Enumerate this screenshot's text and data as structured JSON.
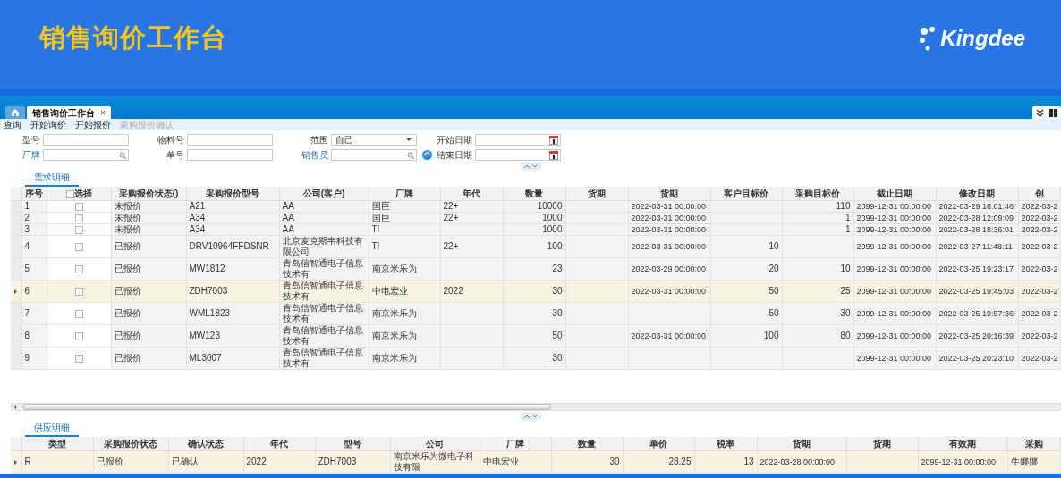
{
  "slide": {
    "title": "销售询价工作台",
    "logo": "Kingdee"
  },
  "tabs": [
    {
      "kind": "home",
      "selected": false
    },
    {
      "kind": "page",
      "label": "销售询价工作台",
      "close": "×",
      "selected": true
    }
  ],
  "toolbar": [
    {
      "label": "查询",
      "disabled": false
    },
    {
      "label": "开始询价",
      "disabled": false
    },
    {
      "label": "开始报价",
      "disabled": false
    },
    {
      "label": "采购报价确认",
      "disabled": true
    }
  ],
  "filters": [
    {
      "label": "型号",
      "kind": "text",
      "link": false
    },
    {
      "label": "物料号",
      "kind": "text",
      "link": false
    },
    {
      "label": "范围",
      "kind": "select",
      "value": "自己",
      "link": false
    },
    {
      "label": "开始日期",
      "kind": "date",
      "link": false
    },
    {
      "label": "厂牌",
      "kind": "lookup",
      "link": true
    },
    {
      "label": "单号",
      "kind": "text",
      "link": false
    },
    {
      "label": "销售员",
      "kind": "lookup",
      "link": true,
      "extra_button": true
    },
    {
      "label": "结束日期",
      "kind": "date",
      "link": false
    }
  ],
  "demand": {
    "tab": "需求明细",
    "select_all": {
      "label": "选择",
      "checked": false
    },
    "columns": [
      "序号",
      "",
      "采购报价状态()",
      "采购报价型号",
      "公司(客户)",
      "厂牌",
      "年代",
      "数量",
      "货期",
      "货期",
      "客户目标价",
      "采购目标价",
      "截止日期",
      "修改日期",
      "创"
    ],
    "rows": [
      {
        "selected": false,
        "checked": false,
        "cells": [
          "1",
          "",
          "未报价",
          "A21",
          "AA",
          "国巨",
          "22+",
          "10000",
          "",
          "2022-03-31 00:00:00",
          "",
          "110",
          "2099-12-31 00:00:00",
          "2022-03-29 16:01:46",
          "2022-03-2"
        ]
      },
      {
        "selected": false,
        "checked": false,
        "cells": [
          "2",
          "",
          "未报价",
          "A34",
          "AA",
          "国巨",
          "22+",
          "1000",
          "",
          "2022-03-31 00:00:00",
          "",
          "1",
          "2099-12-31 00:00:00",
          "2022-03-28 12:09:09",
          "2022-03-2"
        ]
      },
      {
        "selected": false,
        "checked": false,
        "cells": [
          "3",
          "",
          "未报价",
          "A34",
          "AA",
          "TI",
          "",
          "1000",
          "",
          "2022-03-31 00:00:00",
          "",
          "1",
          "2099-12-31 00:00:00",
          "2022-03-28 18:36:01",
          "2022-03-2"
        ]
      },
      {
        "selected": false,
        "checked": false,
        "cells": [
          "4",
          "",
          "已报价",
          "DRV10964FFDSNR",
          "北京麦克斯韦科技有限公司",
          "TI",
          "22+",
          "100",
          "",
          "2022-03-31 00:00:00",
          "10",
          "",
          "2099-12-31 00:00:00",
          "2022-03-27 11:48:11",
          "2022-03-2"
        ]
      },
      {
        "selected": false,
        "checked": false,
        "cells": [
          "5",
          "",
          "已报价",
          "MW1812",
          "青岛信智通电子信息技术有",
          "南京米乐为",
          "",
          "23",
          "",
          "2022-03-29 00:00:00",
          "20",
          "10",
          "2099-12-31 00:00:00",
          "2022-03-25 19:23:17",
          "2022-03-2"
        ]
      },
      {
        "selected": true,
        "checked": false,
        "cells": [
          "6",
          "",
          "已报价",
          "ZDH7003",
          "青岛信智通电子信息技术有",
          "中电宏业",
          "2022",
          "30",
          "",
          "2022-03-31 00:00:00",
          "50",
          "25",
          "2099-12-31 00:00:00",
          "2022-03-25 19:45:03",
          "2022-03-2"
        ]
      },
      {
        "selected": false,
        "checked": false,
        "cells": [
          "7",
          "",
          "已报价",
          "WML1823",
          "青岛信智通电子信息技术有",
          "南京米乐为",
          "",
          "30",
          "",
          "",
          "50",
          "30",
          "2099-12-31 00:00:00",
          "2022-03-25 19:57:36",
          "2022-03-2"
        ]
      },
      {
        "selected": false,
        "checked": false,
        "cells": [
          "8",
          "",
          "已报价",
          "MW123",
          "青岛信智通电子信息技术有",
          "南京米乐为",
          "",
          "50",
          "",
          "2022-03-31 00:00:00",
          "100",
          "80",
          "2099-12-31 00:00:00",
          "2022-03-25 20:16:39",
          "2022-03-2"
        ]
      },
      {
        "selected": false,
        "checked": false,
        "cells": [
          "9",
          "",
          "已报价",
          "ML3007",
          "青岛信智通电子信息技术有",
          "南京米乐为",
          "",
          "30",
          "",
          "",
          "",
          "",
          "2099-12-31 00:00:00",
          "2022-03-25 20:23:10",
          "2022-03-2"
        ]
      }
    ]
  },
  "supply": {
    "tab": "供应明细",
    "columns": [
      "类型",
      "采购报价状态",
      "确认状态",
      "年代",
      "型号",
      "公司",
      "厂牌",
      "数量",
      "单价",
      "税率",
      "货期",
      "货期",
      "有效期",
      "采购"
    ],
    "rows": [
      {
        "selected": true,
        "cells": [
          "R",
          "已报价",
          "已确认",
          "2022",
          "ZDH7003",
          "南京米乐为微电子科技有限",
          "中电宏业",
          "30",
          "28.25",
          "13",
          "2022-03-28 00:00:00",
          "",
          "2099-12-31 00:00:00",
          "牛娜娜"
        ]
      }
    ]
  }
}
